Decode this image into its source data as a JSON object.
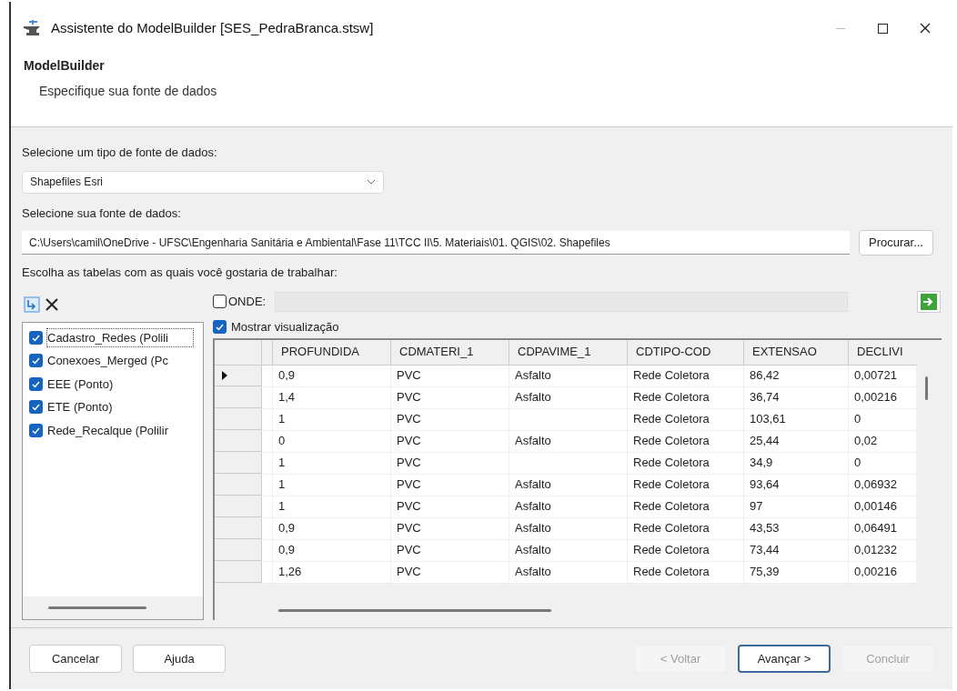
{
  "window": {
    "title": "Assistente do ModelBuilder [SES_PedraBranca.stsw]"
  },
  "header": {
    "title": "ModelBuilder",
    "subtitle": "Especifique sua fonte de dados"
  },
  "source_type": {
    "label": "Selecione um tipo de fonte de dados:",
    "value": "Shapefiles Esri"
  },
  "source": {
    "label": "Selecione sua fonte de dados:",
    "value": "C:\\Users\\camil\\OneDrive - UFSC\\Engenharia Sanitária e Ambiental\\Fase 11\\TCC II\\5. Materiais\\01. QGIS\\02. Shapefiles",
    "browse": "Procurar..."
  },
  "tables_label": "Escolha as tabelas com as quais você gostaria de trabalhar:",
  "tables": [
    {
      "label": "Cadastro_Redes (Polili",
      "checked": true,
      "selected": true
    },
    {
      "label": "Conexoes_Merged (Pc",
      "checked": true,
      "selected": false
    },
    {
      "label": "EEE (Ponto)",
      "checked": true,
      "selected": false
    },
    {
      "label": "ETE (Ponto)",
      "checked": true,
      "selected": false
    },
    {
      "label": "Rede_Recalque (Polilir",
      "checked": true,
      "selected": false
    }
  ],
  "where": {
    "label": "ONDE:",
    "checked": false
  },
  "preview": {
    "label": "Mostrar visualização",
    "checked": true
  },
  "grid": {
    "columns": [
      "PROFUNDIDA",
      "CDMATERI_1",
      "CDPAVIME_1",
      "CDTIPO-COD",
      "EXTENSAO",
      "DECLIVI"
    ],
    "rows": [
      {
        "current": true,
        "cells": [
          "0,9",
          "PVC",
          "Asfalto",
          "Rede Coletora",
          "86,42",
          "0,00721"
        ]
      },
      {
        "current": false,
        "cells": [
          "1,4",
          "PVC",
          "Asfalto",
          "Rede Coletora",
          "36,74",
          "0,00216"
        ]
      },
      {
        "current": false,
        "cells": [
          "1",
          "PVC",
          "",
          "Rede Coletora",
          "103,61",
          "0"
        ]
      },
      {
        "current": false,
        "cells": [
          "0",
          "PVC",
          "Asfalto",
          "Rede Coletora",
          "25,44",
          "0,02"
        ]
      },
      {
        "current": false,
        "cells": [
          "1",
          "PVC",
          "",
          "Rede Coletora",
          "34,9",
          "0"
        ]
      },
      {
        "current": false,
        "cells": [
          "1",
          "PVC",
          "Asfalto",
          "Rede Coletora",
          "93,64",
          "0,06932"
        ]
      },
      {
        "current": false,
        "cells": [
          "1",
          "PVC",
          "Asfalto",
          "Rede Coletora",
          "97",
          "0,00146"
        ]
      },
      {
        "current": false,
        "cells": [
          "0,9",
          "PVC",
          "Asfalto",
          "Rede Coletora",
          "43,53",
          "0,06491"
        ]
      },
      {
        "current": false,
        "cells": [
          "0,9",
          "PVC",
          "Asfalto",
          "Rede Coletora",
          "73,44",
          "0,01232"
        ]
      },
      {
        "current": false,
        "cells": [
          "1,26",
          "PVC",
          "Asfalto",
          "Rede Coletora",
          "75,39",
          "0,00216"
        ]
      }
    ]
  },
  "buttons": [
    {
      "label": "Cancelar",
      "disabled": false,
      "default": false
    },
    {
      "label": "Ajuda",
      "disabled": false,
      "default": false
    },
    {
      "label": "< Voltar",
      "disabled": true,
      "default": false
    },
    {
      "label": "Avançar >",
      "disabled": false,
      "default": true
    },
    {
      "label": "Concluir",
      "disabled": true,
      "default": false
    }
  ]
}
